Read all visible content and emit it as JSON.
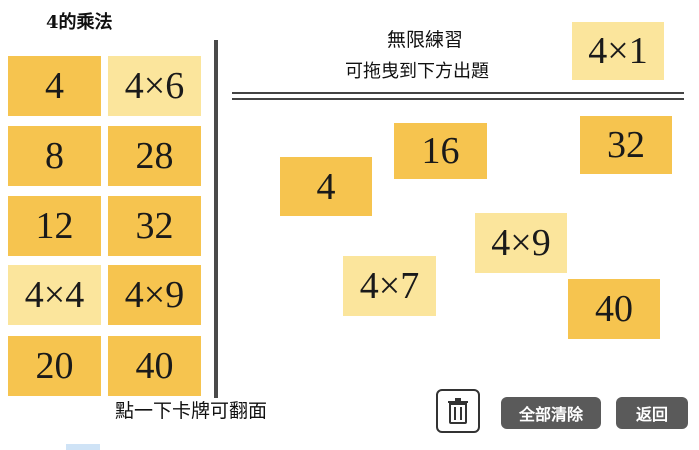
{
  "title": "4的乘法",
  "left_cards": [
    "4",
    "4×6",
    "8",
    "28",
    "12",
    "32",
    "4×4",
    "4×9",
    "20",
    "40"
  ],
  "heading": {
    "line1": "無限練習",
    "line2": "可拖曳到下方出題"
  },
  "preview_card": "4×1",
  "play_cards": [
    "16",
    "32",
    "4",
    "4×9",
    "4×7",
    "40"
  ],
  "hint": "點一下卡牌可翻面",
  "buttons": {
    "clear_all": "全部清除",
    "back": "返回"
  },
  "colors": {
    "card_dark": "#f6c44f",
    "card_light": "#fbe59c",
    "button_bg": "#5a5a5a"
  },
  "icons": [
    "trash-icon"
  ]
}
